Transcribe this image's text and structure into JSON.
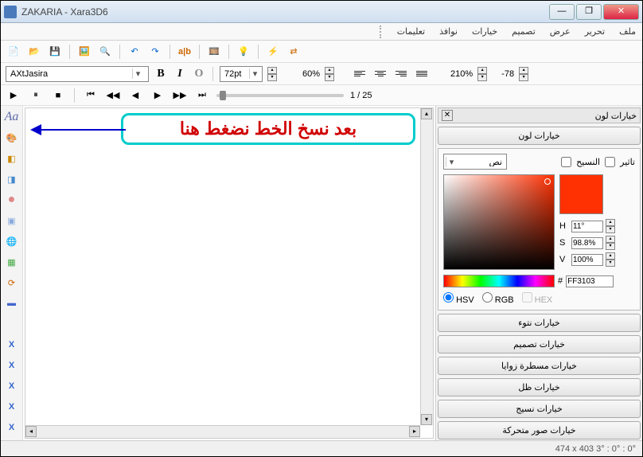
{
  "title": "ZAKARIA - Xara3D6",
  "menu": [
    "ملف",
    "تحرير",
    "عرض",
    "تصميم",
    "خيارات",
    "نوافذ",
    "تعليمات"
  ],
  "font_name": "AXtJasira",
  "font_size": "72pt",
  "zoom1": "60%",
  "zoom2": "210%",
  "value_neg": "-78",
  "frame_counter": "1 / 25",
  "callout": "بعد نسخ الخط نضغط هنا",
  "panel": {
    "title": "خيارات لون",
    "btn_color": "خيارات لون",
    "effect_label": "تاثير",
    "texture_label": "النسيح",
    "dropdown_value": "نص",
    "hsv": {
      "h": "11°",
      "s": "98.8%",
      "v": "100%"
    },
    "hex": "FF3103",
    "mode_hsv": "HSV",
    "mode_rgb": "RGB",
    "mode_hex": "HEX",
    "buttons": [
      "خيارات نتوء",
      "خيارات تصميم",
      "خيارات مسطرة زوايا",
      "خيارات ظل",
      "خيارات نسيج",
      "خيارات صور متحركة"
    ]
  },
  "status": "474 x 403  3° : 0° : 0°"
}
